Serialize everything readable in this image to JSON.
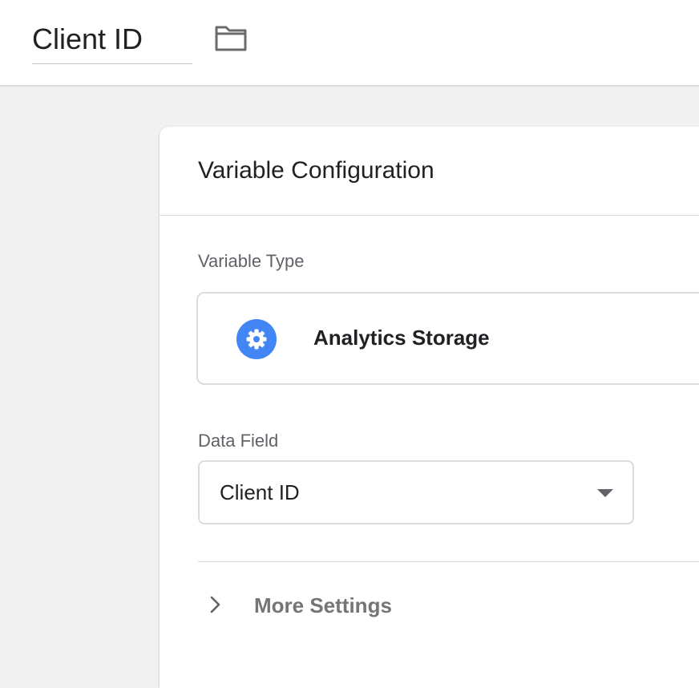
{
  "header": {
    "variable_name": "Client ID",
    "folder_icon": "folder-icon"
  },
  "config": {
    "title": "Variable Configuration",
    "variable_type_label": "Variable Type",
    "variable_type": {
      "name": "Analytics Storage",
      "icon": "gear-icon",
      "icon_color": "#4285f4"
    },
    "data_field_label": "Data Field",
    "data_field": {
      "selected": "Client ID",
      "icon": "dropdown-arrow-icon"
    },
    "more_settings": {
      "label": "More Settings",
      "icon": "chevron-right-icon"
    }
  },
  "colors": {
    "accent": "#4285f4",
    "background": "#f1f1f1",
    "border": "#dadce0",
    "muted_text": "#5f6368"
  }
}
